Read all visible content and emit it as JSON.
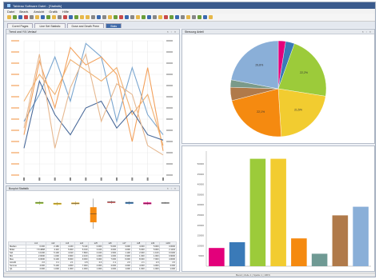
{
  "window": {
    "title": "Tableau Software Datei - [Statistik]"
  },
  "menu": [
    "Datei",
    "Bearb.",
    "Ansicht",
    "Grafik",
    "Hilfe"
  ],
  "toolbar_colors": [
    "#e6b84a",
    "#6a9e3a",
    "#3a6ab0",
    "#c84a4a",
    "#888888",
    "#e6b84a",
    "#3a6ab0",
    "#6a9e3a",
    "#e6b84a",
    "#888888",
    "#c84a4a",
    "#3a6ab0",
    "#6a9e3a",
    "#e6b84a",
    "#e6b84a",
    "#888888",
    "#3a6ab0",
    "#888888",
    "#e6b84a",
    "#6a9e3a",
    "#c84a4a",
    "#3a6ab0",
    "#888888",
    "#e6b84a",
    "#6a9e3a",
    "#3a6ab0",
    "#888888",
    "#e6b84a",
    "#c84a4a",
    "#6a9e3a",
    "#3a6ab0",
    "#888888",
    "#e6b84a",
    "#888888",
    "#6a9e3a",
    "#3a6ab0",
    "#e6b84a"
  ],
  "tabs": [
    "Correl Pages",
    "Line Set Statistic",
    "Dose and Death Prem",
    "Stats"
  ],
  "panels": {
    "line": {
      "title": "Trend und Y/X-Verlauf"
    },
    "pie": {
      "title": "Streuung Anteil"
    },
    "box": {
      "title": "Boxplot Statistik"
    },
    "controls": "× ▫ ×"
  },
  "stats_table": {
    "headers": [
      "",
      "sx1",
      "sx2",
      "sx3",
      "sx4",
      "sx5",
      "sx6",
      "sx7",
      "sx8",
      "sx9",
      "sx10"
    ],
    "rows": [
      [
        "Median",
        "0.000",
        "2.180",
        "4.160",
        "5.110",
        "0.000",
        "5.000",
        "3.000",
        "4.000",
        "5.000",
        "3.0000"
      ],
      [
        "Mittel",
        "7.8 4808",
        "4.110",
        "5.000",
        "6.010",
        "3.100",
        "4.000",
        "4.000",
        "5.000",
        "5.000",
        "2.1104"
      ],
      [
        "Std.",
        "4.1000",
        "5.100",
        "4.010",
        "7.800",
        "4.100",
        "1.500",
        "1.100",
        "2.000",
        "1.100",
        "0.0100"
      ],
      [
        "Min",
        "2.0000",
        "1.000",
        "0.900",
        "2.100",
        "1.000",
        "1.000",
        "0.900",
        "1.000",
        "1.000",
        "0.9000"
      ],
      [
        "Max",
        "9.3000",
        "9.100",
        "8.000",
        "9.000",
        "6.000",
        "7.000",
        "6.000",
        "8.000",
        "7.000",
        "4.0000"
      ],
      [
        "Anzahl",
        "2.0",
        "3.1",
        "2.1",
        "2.8",
        "2.0",
        "2.1",
        "2.0",
        "2.1",
        "2.0",
        "2.0"
      ],
      [
        "Summe",
        "4.000",
        "5.100",
        "4.000",
        "7.000",
        "4.000",
        "4.000",
        "4.000",
        "4.000",
        "4.000",
        "4.000"
      ],
      [
        "Q1",
        "2.000",
        "1.000",
        "1.000",
        "1.000",
        "1.000",
        "1.000",
        "1.000",
        "1.000",
        "1.000",
        "1.000"
      ]
    ]
  },
  "status_bar": "Bereit   |   Zeile 1   |   Spalte 1   |   100%",
  "chart_data": [
    {
      "type": "line",
      "title": "",
      "categories": [
        "1",
        "2",
        "3",
        "4",
        "5",
        "6",
        "7",
        "8",
        "9",
        "10"
      ],
      "ylim": [
        0,
        100
      ],
      "series": [
        {
          "color": "#7aa6d0",
          "values": [
            40,
            60,
            88,
            55,
            98,
            88,
            40,
            80,
            45,
            30
          ]
        },
        {
          "color": "#f3a15c",
          "values": [
            30,
            85,
            50,
            95,
            82,
            88,
            75,
            25,
            80,
            18
          ]
        },
        {
          "color": "#f0b070",
          "values": [
            55,
            75,
            60,
            86,
            78,
            70,
            80,
            45,
            60,
            22
          ]
        },
        {
          "color": "#4a6a9a",
          "values": [
            20,
            70,
            45,
            30,
            50,
            55,
            35,
            48,
            30,
            26
          ]
        },
        {
          "color": "#e6b890",
          "values": [
            35,
            90,
            20,
            65,
            90,
            40,
            68,
            60,
            22,
            15
          ]
        }
      ]
    },
    {
      "type": "pie",
      "slices": [
        {
          "label": "",
          "value": 2.5,
          "color": "#e3007b"
        },
        {
          "label": "",
          "value": 3,
          "color": "#3a7ab8"
        },
        {
          "label": "22,2%",
          "value": 22,
          "color": "#9ccb3a"
        },
        {
          "label": "21,5%",
          "value": 21.5,
          "color": "#f2cc30"
        },
        {
          "label": "22,1%",
          "value": 22,
          "color": "#f58a10"
        },
        {
          "label": "",
          "value": 4.5,
          "color": "#b07a4a"
        },
        {
          "label": "",
          "value": 2.5,
          "color": "#7a9a8a"
        },
        {
          "label": "29,8%",
          "value": 22,
          "color": "#8aafd8"
        }
      ]
    },
    {
      "type": "bar",
      "categories": [
        "1",
        "2",
        "3",
        "4",
        "5",
        "6",
        "7",
        "8"
      ],
      "values": [
        9500,
        12500,
        56000,
        56000,
        14500,
        6500,
        26500,
        31000
      ],
      "colors": [
        "#e3007b",
        "#3a7ab8",
        "#9ccb3a",
        "#f2cc30",
        "#f58a10",
        "#6f9a94",
        "#b07a4a",
        "#8aafd8"
      ],
      "ylim": [
        0,
        60000
      ],
      "ticks": [
        "50000",
        "45000",
        "40000",
        "35000",
        "30000",
        "25000",
        "20000",
        "15000",
        "10000",
        "5000"
      ]
    },
    {
      "type": "box",
      "boxes": [
        {
          "median": 80,
          "q1": 78,
          "q3": 82,
          "min": 76,
          "max": 84
        },
        {
          "median": 78,
          "q1": 76,
          "q3": 80,
          "min": 74,
          "max": 82
        },
        {
          "median": 79,
          "q1": 77,
          "q3": 81,
          "min": 75,
          "max": 83
        },
        {
          "median": 55,
          "q1": 35,
          "q3": 70,
          "min": 20,
          "max": 90
        },
        {
          "median": 82,
          "q1": 80,
          "q3": 83,
          "min": 78,
          "max": 85
        },
        {
          "median": 80,
          "q1": 78,
          "q3": 82,
          "min": 76,
          "max": 84
        },
        {
          "median": 79,
          "q1": 77,
          "q3": 81,
          "min": 75,
          "max": 83
        },
        {
          "median": 80,
          "q1": 79,
          "q3": 81,
          "min": 78,
          "max": 82
        }
      ],
      "colors": [
        "#9ccb3a",
        "#f2cc30",
        "#e6b84a",
        "#f58a10",
        "#c84a4a",
        "#3a7ab8",
        "#e3007b",
        "#888888"
      ]
    }
  ]
}
